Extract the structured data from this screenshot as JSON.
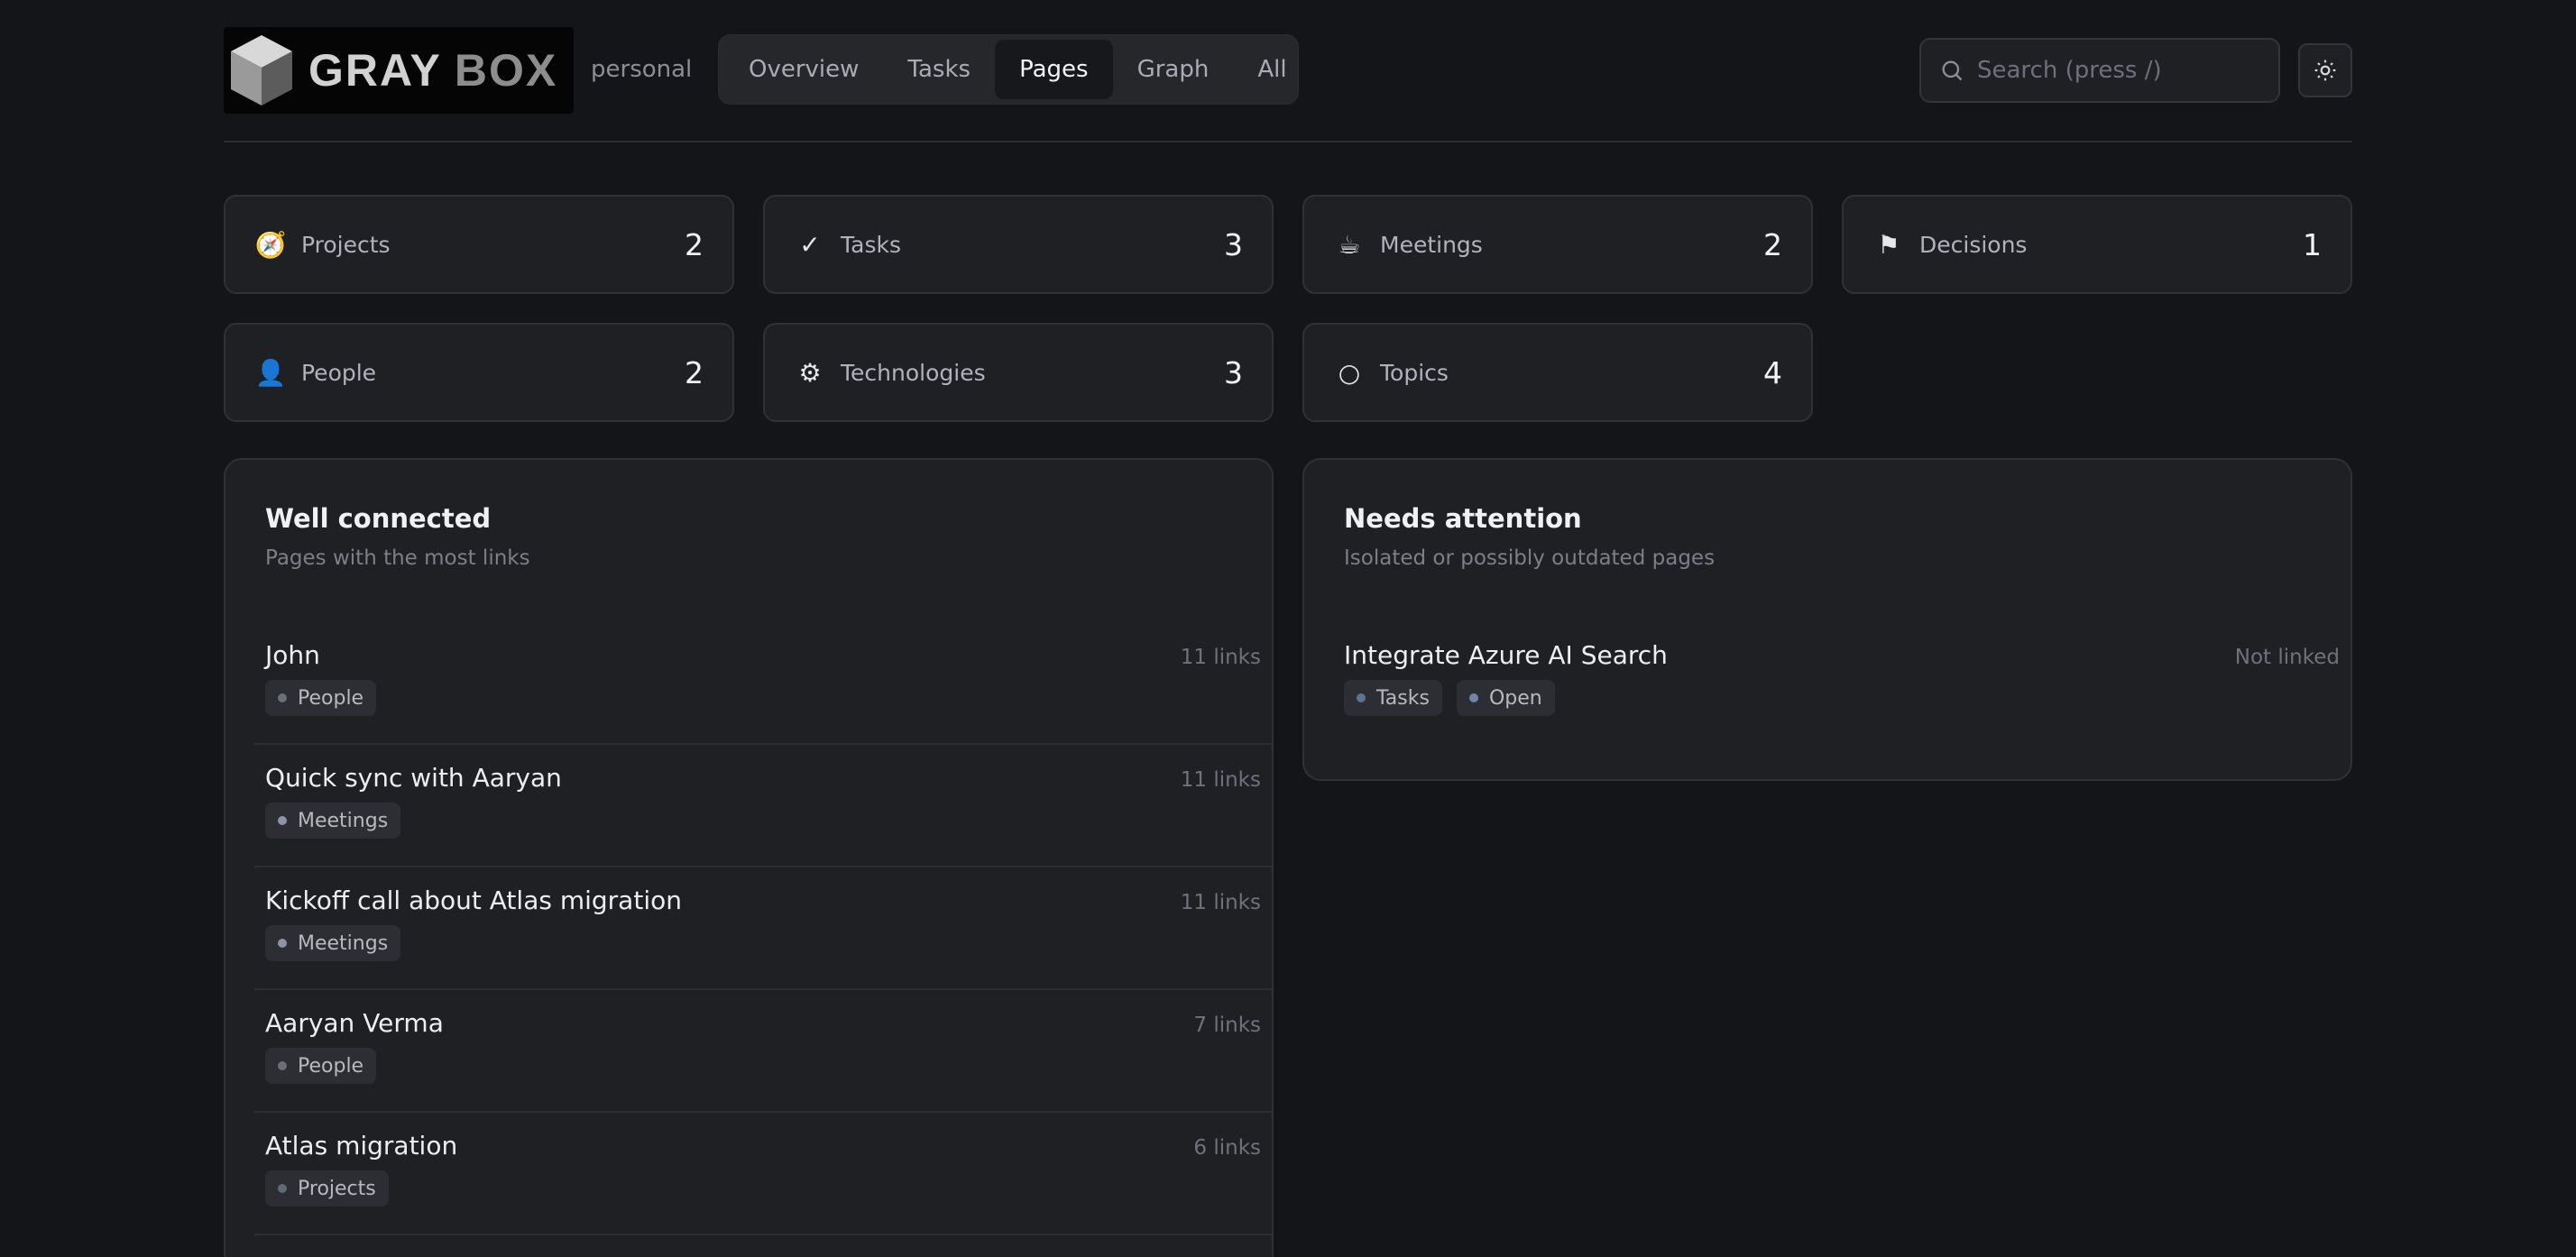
{
  "app": {
    "logo_text_1": "GRAY",
    "logo_text_2": "BOX",
    "workspace": "personal"
  },
  "nav": {
    "tabs": [
      {
        "label": "Overview",
        "active": false
      },
      {
        "label": "Tasks",
        "active": false
      },
      {
        "label": "Pages",
        "active": true
      },
      {
        "label": "Graph",
        "active": false
      },
      {
        "label": "All",
        "active": false
      }
    ]
  },
  "search": {
    "placeholder": "Search (press /)",
    "value": ""
  },
  "stats": [
    {
      "icon": "compass-icon",
      "glyph": "🧭",
      "label": "Projects",
      "count": "2"
    },
    {
      "icon": "check-icon",
      "glyph": "✓",
      "label": "Tasks",
      "count": "3"
    },
    {
      "icon": "coffee-icon",
      "glyph": "☕",
      "label": "Meetings",
      "count": "2"
    },
    {
      "icon": "flag-icon",
      "glyph": "⚑",
      "label": "Decisions",
      "count": "1"
    },
    {
      "icon": "person-icon",
      "glyph": "👤",
      "label": "People",
      "count": "2"
    },
    {
      "icon": "gear-icon",
      "glyph": "⚙",
      "label": "Technologies",
      "count": "3"
    },
    {
      "icon": "circle-icon",
      "glyph": "○",
      "label": "Topics",
      "count": "4"
    }
  ],
  "well_connected": {
    "title": "Well connected",
    "subtitle": "Pages with the most links",
    "items": [
      {
        "title": "John",
        "meta": "11 links",
        "tags": [
          "People"
        ]
      },
      {
        "title": "Quick sync with Aaryan",
        "meta": "11 links",
        "tags": [
          "Meetings"
        ]
      },
      {
        "title": "Kickoff call about Atlas migration",
        "meta": "11 links",
        "tags": [
          "Meetings"
        ]
      },
      {
        "title": "Aaryan Verma",
        "meta": "7 links",
        "tags": [
          "People"
        ]
      },
      {
        "title": "Atlas migration",
        "meta": "6 links",
        "tags": [
          "Projects"
        ]
      }
    ]
  },
  "needs_attention": {
    "title": "Needs attention",
    "subtitle": "Isolated or possibly outdated pages",
    "items": [
      {
        "title": "Integrate Azure AI Search",
        "meta": "Not linked",
        "tags": [
          "Tasks",
          "Open"
        ]
      }
    ]
  },
  "colors": {
    "background": "#141518",
    "card": "#1f2024",
    "tag_dot_people": "#6b6f78",
    "tag_dot_meetings": "#8f93a6",
    "tag_dot_projects": "#5f6b73",
    "tag_dot_tasks": "#5d7590",
    "tag_dot_open": "#6f86a8"
  }
}
